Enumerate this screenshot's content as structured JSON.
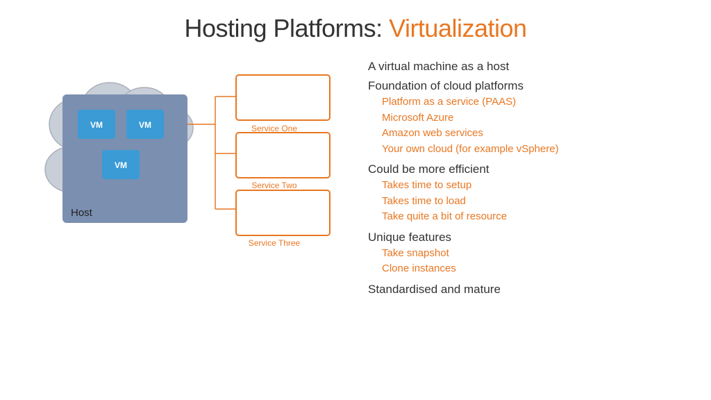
{
  "title": {
    "prefix": "Hosting Platforms: ",
    "highlight": "Virtualization"
  },
  "diagram": {
    "host_label": "Host",
    "vm_labels": [
      "VM",
      "VM",
      "VM"
    ],
    "service_labels": [
      "Service One",
      "Service Two",
      "Service Three"
    ]
  },
  "bullets": [
    {
      "main": "A virtual machine as a host",
      "subs": []
    },
    {
      "main": "Foundation of cloud platforms",
      "subs": [
        "Platform as a service (PAAS)",
        "Microsoft Azure",
        "Amazon web services",
        "Your own cloud (for example vSphere)"
      ]
    },
    {
      "main": "Could be more efficient",
      "subs": [
        "Takes time to setup",
        "Takes time to load",
        "Take quite a bit of resource"
      ]
    },
    {
      "main": "Unique features",
      "subs": [
        "Take snapshot",
        "Clone instances"
      ]
    },
    {
      "main": "Standardised and mature",
      "subs": []
    }
  ]
}
